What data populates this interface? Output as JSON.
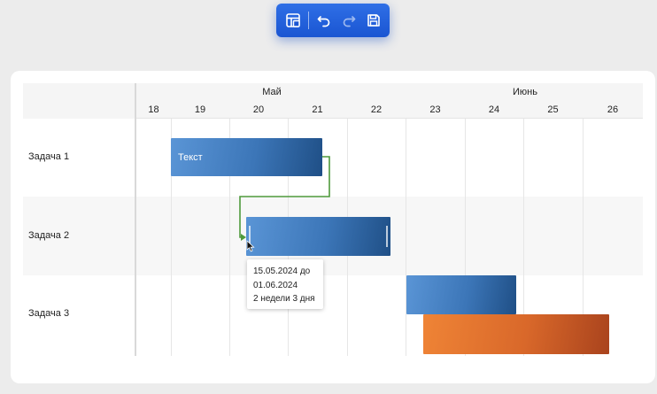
{
  "toolbar": {
    "buttons": [
      {
        "name": "layout-icon",
        "disabled": false
      },
      {
        "name": "undo-icon",
        "disabled": false
      },
      {
        "name": "redo-icon",
        "disabled": true
      },
      {
        "name": "save-icon",
        "disabled": false
      }
    ]
  },
  "gantt": {
    "months": [
      "Май",
      "Июнь"
    ],
    "days": [
      "18",
      "19",
      "20",
      "21",
      "22",
      "23",
      "24",
      "25",
      "26"
    ],
    "rows": [
      "Задача 1",
      "Задача 2",
      "Задача 3"
    ],
    "bars": [
      {
        "task": "Задача 1",
        "label": "Текст",
        "color": "blue"
      },
      {
        "task": "Задача 2",
        "label": "",
        "color": "blue"
      },
      {
        "task": "Задача 3",
        "label": "",
        "color": "blue"
      },
      {
        "task": "Задача 3",
        "label": "",
        "color": "orange"
      }
    ],
    "tooltip": {
      "line1": "15.05.2024 до",
      "line2": "01.06.2024",
      "line3": "2 недели 3 дня"
    },
    "colors": {
      "bar_blue": "#3c76b8",
      "bar_orange": "#d9682a",
      "link": "#4f9a3c",
      "toolbar": "#1f5fdc"
    }
  }
}
